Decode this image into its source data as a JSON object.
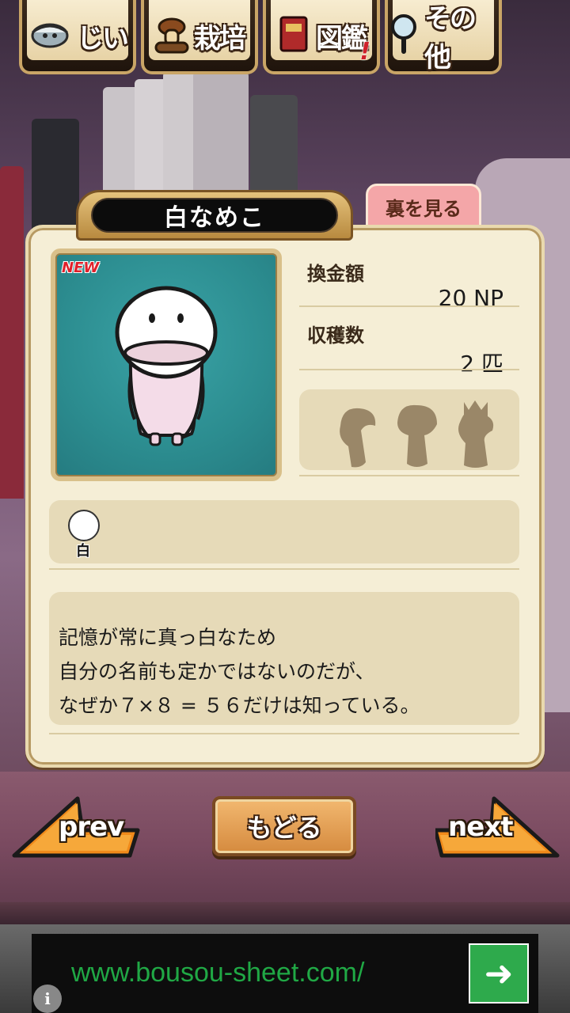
{
  "nav": {
    "tabs": [
      {
        "label": "じい",
        "icon": "elder-icon"
      },
      {
        "label": "栽培",
        "icon": "mushroom-log-icon"
      },
      {
        "label": "図鑑",
        "icon": "book-icon",
        "alert": "!"
      },
      {
        "label": "その他",
        "icon": "magnifier-icon"
      }
    ]
  },
  "card": {
    "name": "白なめこ",
    "flip_label": "裏を見る",
    "new_badge": "NEW",
    "price_label": "換金額",
    "price_value": "20 NP",
    "harvest_label": "収穫数",
    "harvest_value": "2 匹",
    "location_label": "白",
    "description": [
      "記憶が常に真っ白なため",
      "自分の名前も定かではないのだが、",
      "なぜか７×８ = ５６だけは知っている。"
    ]
  },
  "buttons": {
    "prev": "prev",
    "back": "もどる",
    "next": "next"
  },
  "ad": {
    "url": "www.bousou-sheet.com/",
    "go_symbol": "➜",
    "info_symbol": "i"
  },
  "colors": {
    "portrait_bg": "#2c8d90",
    "card_bg": "#f5eed6",
    "accent_orange": "#f08a1a",
    "ad_green": "#2eaa4c",
    "flip_tab": "#f4a6a8"
  }
}
